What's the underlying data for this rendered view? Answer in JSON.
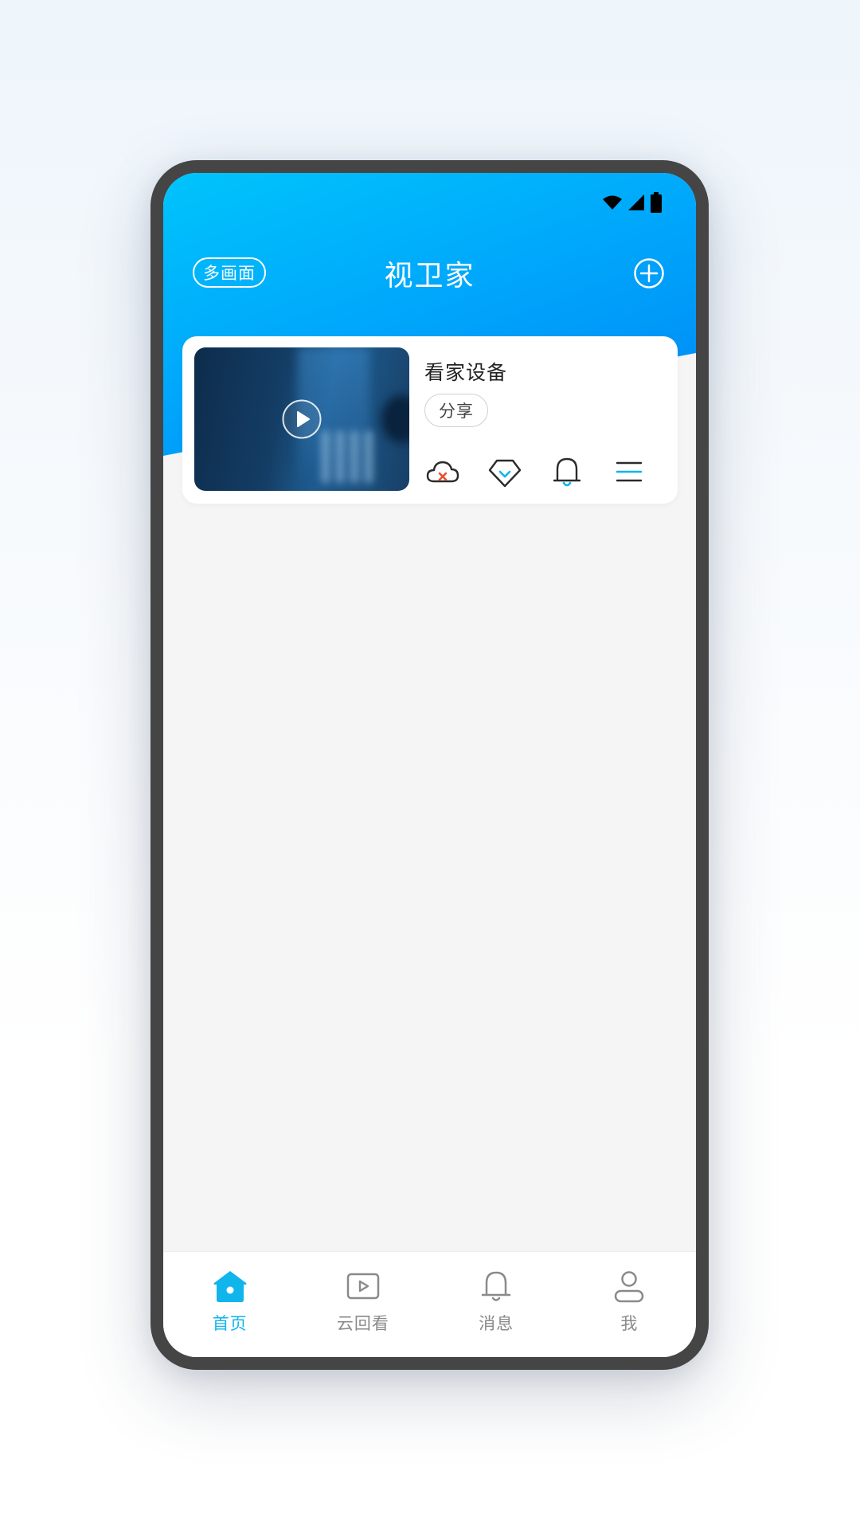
{
  "header": {
    "title": "视卫家",
    "multi_view_label": "多画面"
  },
  "status_bar": {
    "icons": [
      "wifi-icon",
      "signal-icon",
      "battery-icon"
    ]
  },
  "device_card": {
    "name": "看家设备",
    "share_label": "分享",
    "actions": [
      "cloud-off-icon",
      "diamond-icon",
      "bell-icon",
      "menu-icon"
    ]
  },
  "bottom_nav": {
    "items": [
      {
        "label": "首页",
        "icon": "home-icon",
        "active": true
      },
      {
        "label": "云回看",
        "icon": "video-play-icon",
        "active": false
      },
      {
        "label": "消息",
        "icon": "bell-icon",
        "active": false
      },
      {
        "label": "我",
        "icon": "user-icon",
        "active": false
      }
    ]
  },
  "colors": {
    "accent": "#10b5ec",
    "header_start": "#00c4fb",
    "header_end": "#0085f5",
    "alert_red": "#e8502f"
  }
}
